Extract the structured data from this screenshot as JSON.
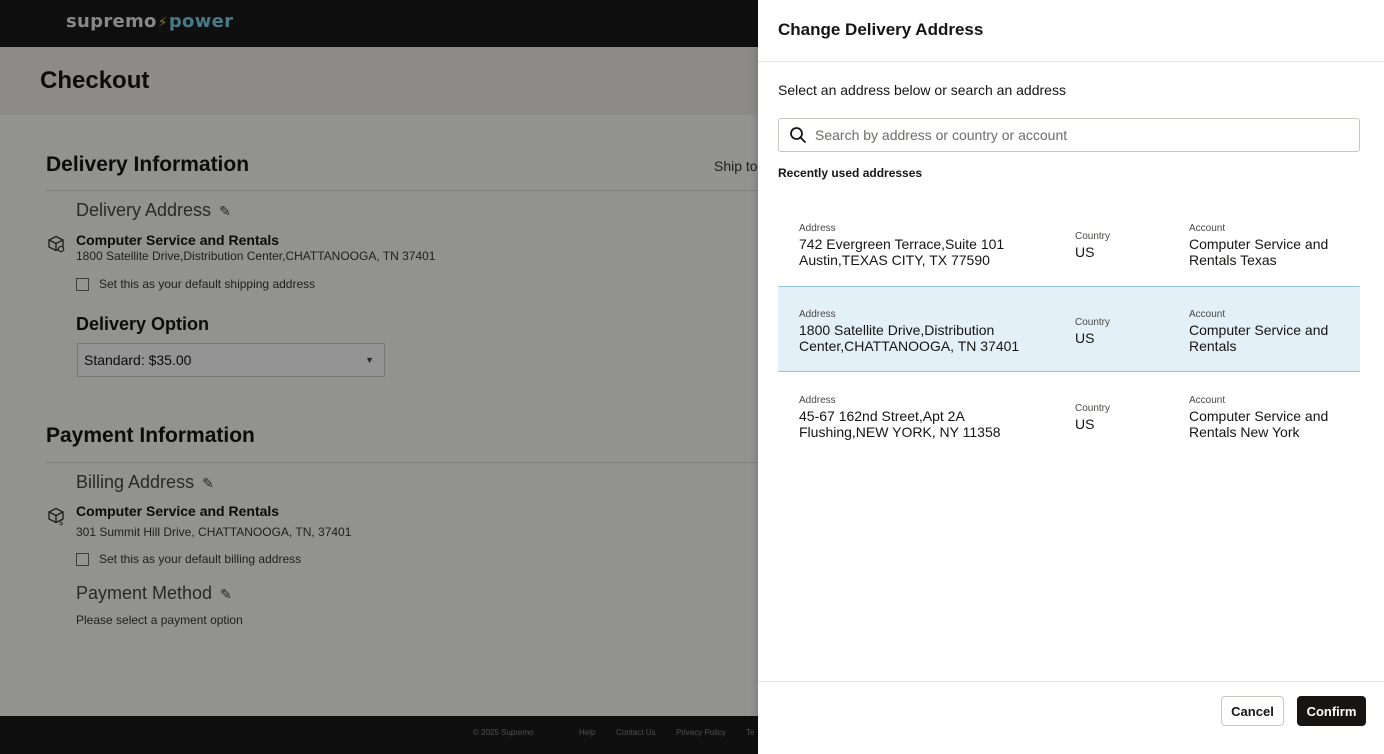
{
  "brand": {
    "logo_left": "supremo",
    "logo_right": "power"
  },
  "page": {
    "title": "Checkout"
  },
  "delivery": {
    "section_title": "Delivery Information",
    "ship_to": "Ship to",
    "address_heading": "Delivery Address",
    "address_name": "Computer Service and Rentals",
    "address_line": "1800 Satellite Drive,Distribution Center,CHATTANOOGA, TN 37401",
    "default_checkbox_label": "Set this as your default shipping address",
    "option_heading": "Delivery Option",
    "option_value": "Standard: $35.00"
  },
  "payment": {
    "section_title": "Payment Information",
    "billing_heading": "Billing Address",
    "billing_name": "Computer Service and Rentals",
    "billing_line": "301 Summit Hill Drive, CHATTANOOGA, TN, 37401",
    "default_checkbox_label": "Set this as your default billing address",
    "method_heading": "Payment Method",
    "method_note": "Please select a payment option"
  },
  "footer": {
    "copyright": "© 2025 Supremo",
    "help": "Help",
    "contact": "Contact Us",
    "privacy": "Privacy Policy",
    "terms_partial": "Te"
  },
  "drawer": {
    "title": "Change Delivery Address",
    "instructions": "Select an address below or search an address",
    "search_placeholder": "Search by address or country or account",
    "recent_heading": "Recently used addresses",
    "labels": {
      "address": "Address",
      "country": "Country",
      "account": "Account"
    },
    "addresses": [
      {
        "address": "742 Evergreen Terrace,Suite 101 Austin,TEXAS CITY, TX 77590",
        "country": "US",
        "account": "Computer Service and Rentals Texas",
        "selected": false
      },
      {
        "address": "1800 Satellite Drive,Distribution Center,CHATTANOOGA, TN 37401",
        "country": "US",
        "account": "Computer Service and Rentals",
        "selected": true
      },
      {
        "address": "45-67 162nd Street,Apt 2A Flushing,NEW YORK, NY 11358",
        "country": "US",
        "account": "Computer Service and Rentals New York",
        "selected": false
      }
    ],
    "cancel_label": "Cancel",
    "confirm_label": "Confirm"
  },
  "colors": {
    "topbar": "#1b1b1b",
    "selected_row": "#e4f0f7",
    "selected_border": "#94c1de",
    "confirm_button": "#161513"
  }
}
